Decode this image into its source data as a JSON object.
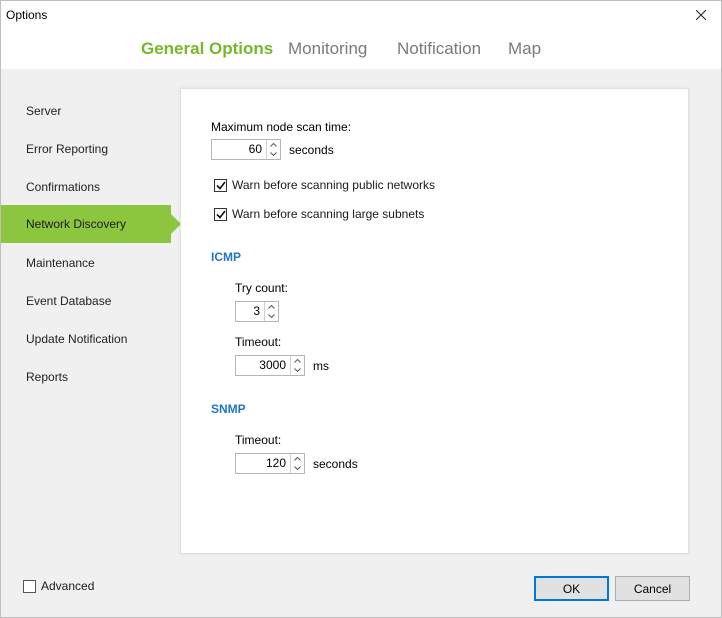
{
  "window": {
    "title": "Options"
  },
  "tabs": [
    {
      "label": "General Options",
      "active": true
    },
    {
      "label": "Monitoring",
      "active": false
    },
    {
      "label": "Notification",
      "active": false
    },
    {
      "label": "Map",
      "active": false
    }
  ],
  "sidebar": {
    "items": [
      {
        "label": "Server"
      },
      {
        "label": "Error Reporting"
      },
      {
        "label": "Confirmations"
      },
      {
        "label": "Network Discovery",
        "active": true
      },
      {
        "label": "Maintenance"
      },
      {
        "label": "Event Database"
      },
      {
        "label": "Update Notification"
      },
      {
        "label": "Reports"
      }
    ]
  },
  "panel": {
    "max_scan": {
      "label": "Maximum node scan time:",
      "value": "60",
      "unit": "seconds"
    },
    "warn_public": {
      "label": "Warn before scanning public networks",
      "checked": true
    },
    "warn_large": {
      "label": "Warn before scanning large subnets",
      "checked": true
    },
    "icmp": {
      "heading": "ICMP",
      "try_count": {
        "label": "Try count:",
        "value": "3"
      },
      "timeout": {
        "label": "Timeout:",
        "value": "3000",
        "unit": "ms"
      }
    },
    "snmp": {
      "heading": "SNMP",
      "timeout": {
        "label": "Timeout:",
        "value": "120",
        "unit": "seconds"
      }
    }
  },
  "footer": {
    "advanced": {
      "label": "Advanced",
      "checked": false
    },
    "ok_label": "OK",
    "cancel_label": "Cancel"
  },
  "colors": {
    "accent_green": "#8cc63f",
    "tab_active": "#77b82a",
    "section_blue": "#1f76c2",
    "button_focus": "#0078d7"
  }
}
